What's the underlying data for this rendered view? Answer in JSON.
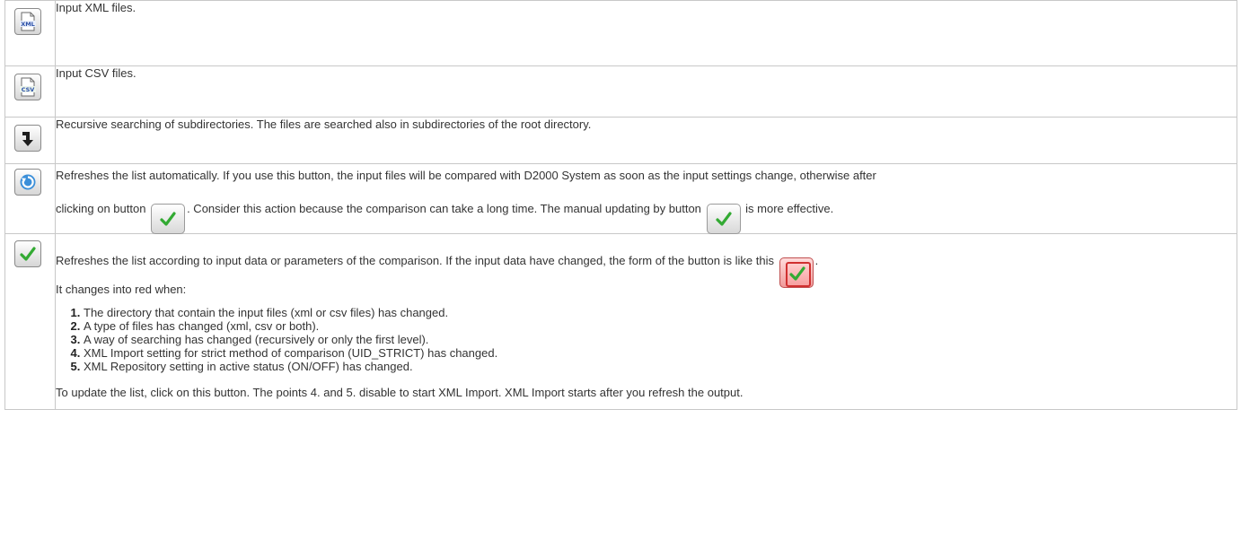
{
  "rows": [
    {
      "icon": "xml-file-icon",
      "text": "Input XML files."
    },
    {
      "icon": "csv-file-icon",
      "text": "Input CSV files."
    },
    {
      "icon": "recursive-arrow-icon",
      "text": "Recursive searching of subdirectories. The files are searched also in subdirectories of the root directory."
    },
    {
      "icon": "refresh-auto-icon",
      "text_part1": "Refreshes the list automatically. If you use this button, the input files will be compared with D2000 System as soon as the input settings change, otherwise after",
      "text_part2": "clicking on button",
      "text_part3": ". Consider this action because the comparison can take a long time. The manual updating by button",
      "text_part4": "is more effective."
    },
    {
      "icon": "green-check-icon",
      "text_part1": "Refreshes the list according to input data or parameters of the comparison. If the input data have changed, the form of the button is like this",
      "text_part2": ".",
      "red_intro": "It changes into red when:",
      "list": [
        "The directory that contain the input files (xml or csv files) has changed.",
        "A type of files has changed (xml, csv or both).",
        "A way of searching has changed (recursively or only the first level).",
        "XML Import setting for strict method of comparison (UID_STRICT) has changed.",
        "XML Repository setting in active status (ON/OFF) has changed."
      ],
      "footer": "To update the list, click on this button. The points 4. and 5. disable to start XML Import. XML Import starts after you refresh the output."
    }
  ],
  "colors": {
    "check_green": "#33aa33",
    "refresh_blue": "#3b8fd9",
    "red_state": "#d03030",
    "border": "#c8c8c8"
  }
}
